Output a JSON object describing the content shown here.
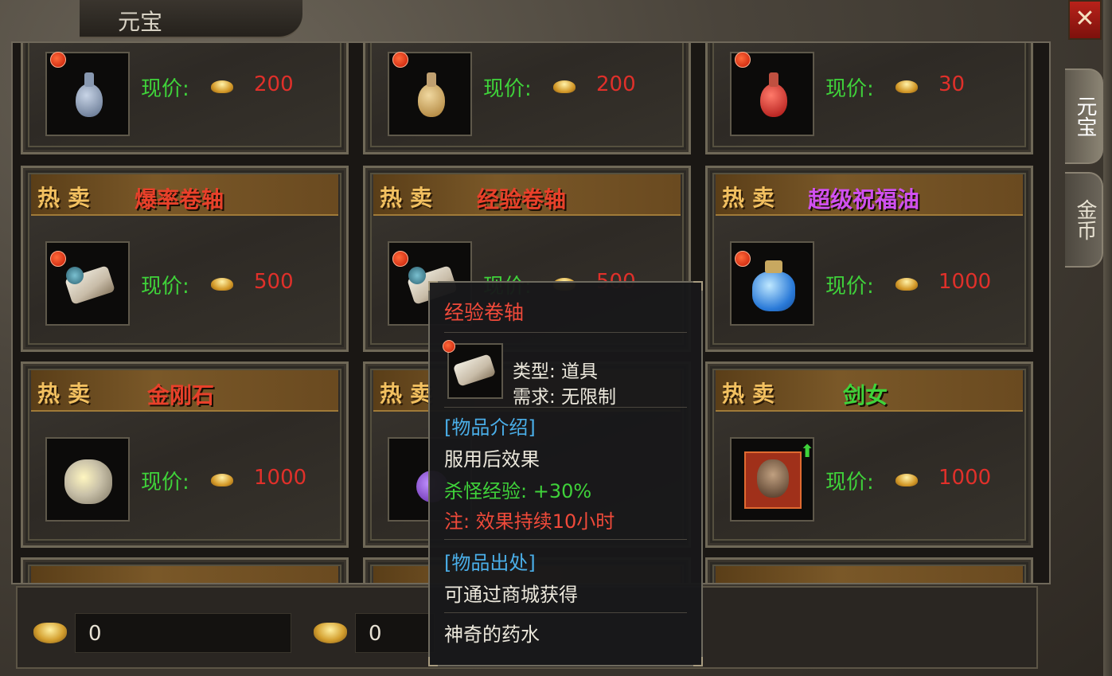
{
  "window": {
    "title": "元宝",
    "close_label": "✕",
    "tabs": [
      {
        "label": "元宝",
        "active": true
      },
      {
        "label": "金币",
        "active": false
      }
    ]
  },
  "labels": {
    "hot": "热卖",
    "price": "现价:"
  },
  "items_row0": [
    {
      "price": "200"
    },
    {
      "price": "200"
    },
    {
      "price": "30"
    }
  ],
  "items_row1": [
    {
      "name": "爆率卷轴",
      "name_color": "#e8402a",
      "price": "500"
    },
    {
      "name": "经验卷轴",
      "name_color": "#e8402a",
      "price": "500"
    },
    {
      "name": "超级祝福油",
      "name_color": "#d050f0",
      "price": "1000"
    }
  ],
  "items_row2": [
    {
      "name": "金刚石",
      "name_color": "#e8402a",
      "price": "1000"
    },
    {
      "name": "",
      "name_color": "#e8402a",
      "price": ""
    },
    {
      "name": "剑女",
      "name_color": "#3fd23a",
      "price": "1000"
    }
  ],
  "bottom": {
    "yuanbao_value": "0",
    "gold_value": "0"
  },
  "tooltip": {
    "title": "经验卷轴",
    "type": "类型: 道具",
    "requirement": "需求: 无限制",
    "intro_header": "[物品介绍]",
    "intro_line": "服用后效果",
    "effect": "杀怪经验: +30%",
    "note": "注: 效果持续10小时",
    "source_header": "[物品出处]",
    "source_line": "可通过商城获得",
    "desc": "神奇的药水"
  },
  "colors": {
    "price_label": "#3fd23a",
    "price_value": "#e0302a",
    "tooltip_header": "#4aaee8"
  }
}
